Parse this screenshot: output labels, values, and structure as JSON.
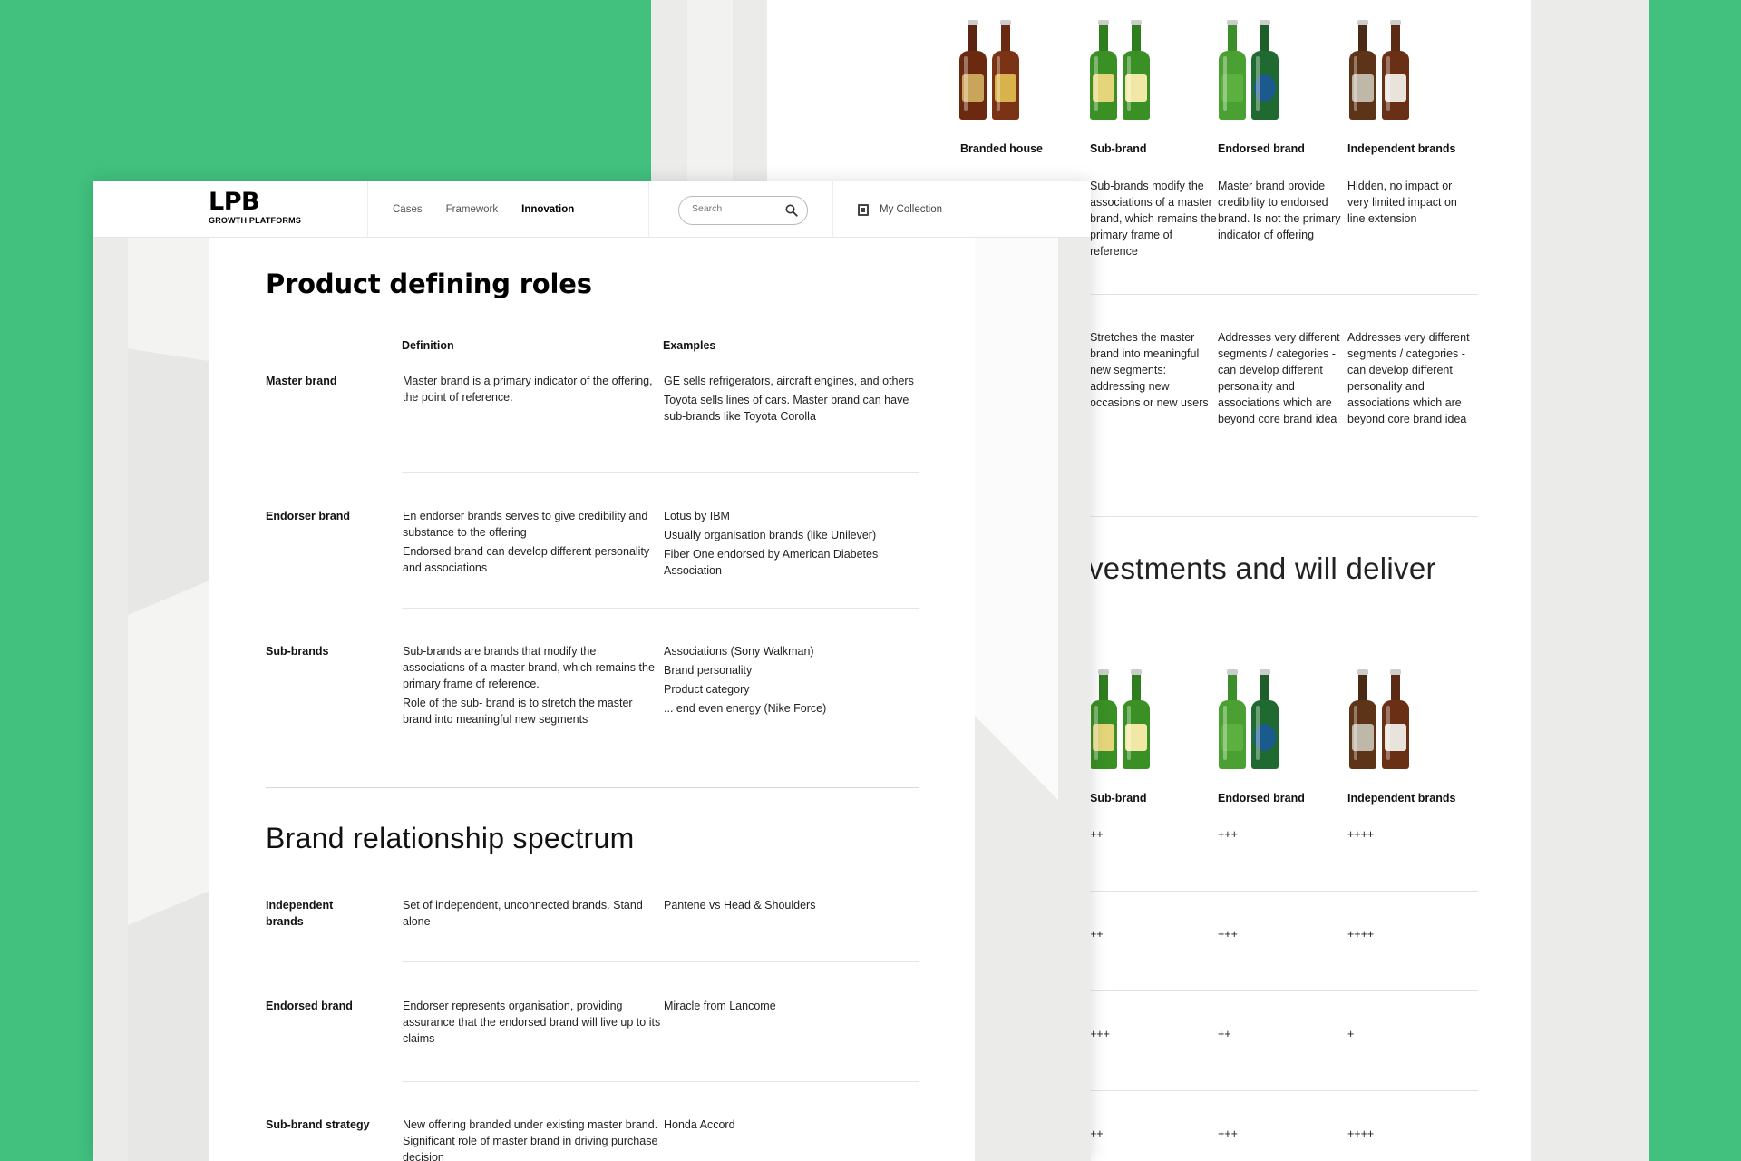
{
  "back": {
    "columns": [
      {
        "title": "Branded house",
        "def": "",
        "role": ""
      },
      {
        "title": "Sub-brand",
        "def": "Sub-brands modify the associations of a master brand, which remains the primary frame of reference",
        "role": "Stretches the master brand into meaningful new segments: addressing new occasions or new users"
      },
      {
        "title": "Endorsed brand",
        "def": "Master brand provide credibility to endorsed brand. Is not the primary indicator of offering",
        "role": "Addresses very different segments / categories - can develop different personality and associations which are beyond core brand idea"
      },
      {
        "title": "Independent brands",
        "def": "Hidden, no impact or very limited impact on line extension",
        "role": "Addresses very different segments  / categories - can develop different personality and associations which are beyond core brand idea"
      }
    ],
    "heading_fragment": "vestments and will deliver",
    "lower_titles": [
      "Sub-brand",
      "Endorsed brand",
      "Independent brands"
    ],
    "ratings": [
      [
        "++",
        "+++",
        "++++"
      ],
      [
        "++",
        "+++",
        "++++"
      ],
      [
        "+++",
        "++",
        "+"
      ],
      [
        "++",
        "+++",
        "++++"
      ]
    ]
  },
  "header": {
    "logo_big": "LPB",
    "logo_small": "GROWTH PLATFORMS",
    "nav": [
      "Cases",
      "Framework",
      "Innovation"
    ],
    "active_nav": "Innovation",
    "search_placeholder": "Search",
    "collection_label": "My Collection"
  },
  "page": {
    "title": "Product defining roles",
    "col_definition": "Definition",
    "col_examples": "Examples",
    "roles": [
      {
        "label": "Master brand",
        "definition": [
          "Master brand is a primary indicator of the offering, the point of reference."
        ],
        "examples": [
          "GE sells refrigerators, aircraft engines, and others",
          "Toyota sells lines of cars. Master brand can have sub-brands like Toyota Corolla"
        ]
      },
      {
        "label": "Endorser brand",
        "definition": [
          "En endorser brands serves to give credibility and substance to the offering",
          "Endorsed brand can develop different personality and associations"
        ],
        "examples": [
          "Lotus by IBM",
          "Usually organisation brands (like Unilever)",
          "Fiber One endorsed by American Diabetes Association"
        ]
      },
      {
        "label": "Sub-brands",
        "definition": [
          "Sub-brands are brands that modify the associations of a master brand, which remains the primary frame of reference.",
          "Role of the sub- brand is to stretch the master brand into meaningful new segments"
        ],
        "examples": [
          "Associations (Sony Walkman)",
          "Brand personality",
          "Product category",
          "... end even energy (Nike Force)"
        ]
      }
    ],
    "spectrum_title": "Brand relationship spectrum",
    "spectrum": [
      {
        "label": "Independent brands",
        "definition": "Set of independent, unconnected brands. Stand alone",
        "example": "Pantene vs Head & Shoulders"
      },
      {
        "label": "Endorsed brand",
        "definition": "Endorser represents organisation, providing assurance that the endorsed brand will live up to its claims",
        "example": "Miracle from Lancome"
      },
      {
        "label": "Sub-brand strategy",
        "definition": "New offering branded under existing master brand. Significant role of master brand in driving purchase decision",
        "example": "Honda Accord"
      }
    ]
  },
  "colors": {
    "background": "#41c07e",
    "page_gray": "#ebebea"
  }
}
